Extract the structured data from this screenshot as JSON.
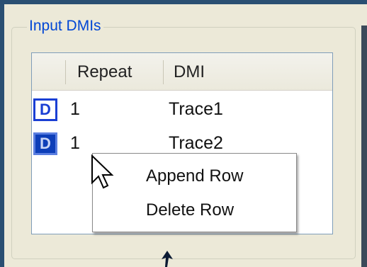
{
  "group": {
    "title": "Input DMIs"
  },
  "table": {
    "columns": [
      "Repeat",
      "DMI"
    ],
    "rows": [
      {
        "badge": "D",
        "repeat": "1",
        "dmi": "Trace1",
        "selected": false
      },
      {
        "badge": "D",
        "repeat": "1",
        "dmi": "Trace2",
        "selected": true
      }
    ]
  },
  "context_menu": {
    "items": [
      "Append Row",
      "Delete Row"
    ]
  },
  "colors": {
    "accent": "#0046d5",
    "selected_badge": "#0d3eb8",
    "background": "#ece9d8"
  }
}
